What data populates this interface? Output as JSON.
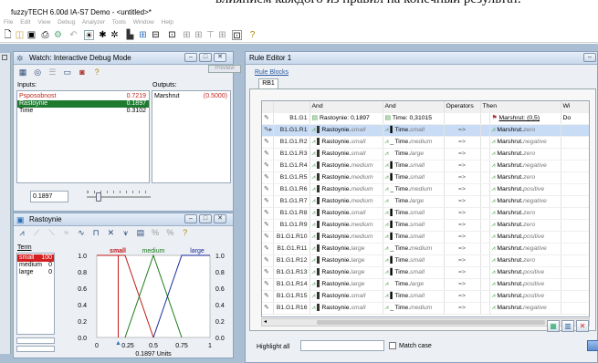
{
  "top_caption": "влиянием каждого из правил на конечный результат.",
  "app": {
    "title": "fuzzyTECH 6.00d IA-S7 Demo - <untitled>*"
  },
  "menu": [
    "File",
    "Edit",
    "View",
    "Debug",
    "Analyzer",
    "Tools",
    "Window",
    "Help"
  ],
  "toolbar_icons": [
    "new-icon",
    "open-icon",
    "save-icon",
    "print-icon",
    "compile-icon",
    "undo-icon",
    "debug-icon",
    "variables-icon",
    "rules-icon",
    "analyzer-icon",
    "chart-icon",
    "plot-icon",
    "window-icon",
    "window2-icon",
    "window3-icon",
    "window4-icon",
    "window5-icon",
    "layout-icon",
    "help-icon"
  ],
  "watch": {
    "title": "Watch: Interactive Debug Mode",
    "partial_title": "Preview",
    "inputs_label": "Inputs:",
    "outputs_label": "Outputs:",
    "inputs": [
      {
        "name": "Psposobnost",
        "value": "0.7219",
        "selected": false
      },
      {
        "name": "Rastoynie",
        "value": "0.1897",
        "selected": true
      },
      {
        "name": "Time",
        "value": "0.3102",
        "selected": false
      }
    ],
    "outputs": [
      {
        "name": "Marshrut",
        "value": "(0.5000)"
      }
    ],
    "input_value": "0.1897",
    "slider_value": 0.19
  },
  "var_editor": {
    "title": "Rastoynie",
    "term_label": "Term",
    "terms": [
      {
        "name": "small",
        "value": "100",
        "selected": true
      },
      {
        "name": "medium",
        "value": "0",
        "selected": false
      },
      {
        "name": "large",
        "value": "0",
        "selected": false
      }
    ],
    "chart_terms": [
      "small",
      "medium",
      "large"
    ],
    "y_ticks": [
      "1.0",
      "0.8",
      "0.6",
      "0.4",
      "0.2",
      "0.0"
    ],
    "x_ticks": [
      "0",
      "0.25",
      "0.5",
      "0.75",
      "1"
    ],
    "x_readout": "0.1897 Units",
    "marker_value": 0.1897
  },
  "rule_editor": {
    "title": "Rule Editor 1",
    "rule_blocks_label": "Rule Blocks",
    "tab": "RB1",
    "headers": {
      "and1": "And",
      "and2": "And",
      "operators": "Operators",
      "then": "Then",
      "w": "Wi",
      "do": "Do"
    },
    "row0": {
      "id": "B1.G1",
      "rast": "Rastoynie: 0,1897",
      "time": "Time: 0,31015",
      "then": "Marshrut: (0,5)"
    },
    "rules": [
      {
        "id": "B1.G1.R1",
        "rast": "small",
        "time": "small",
        "out": "zero",
        "sel": true
      },
      {
        "id": "B1.G1.R2",
        "rast": "small",
        "time": "medium",
        "out": "negative",
        "sel": false
      },
      {
        "id": "B1.G1.R3",
        "rast": "small",
        "time": "large",
        "out": "zero",
        "sel": false
      },
      {
        "id": "B1.G1.R4",
        "rast": "medium",
        "time": "small",
        "out": "negative",
        "sel": false
      },
      {
        "id": "B1.G1.R5",
        "rast": "medium",
        "time": "small",
        "out": "zero",
        "sel": false
      },
      {
        "id": "B1.G1.R6",
        "rast": "medium",
        "time": "medium",
        "out": "positive",
        "sel": false
      },
      {
        "id": "B1.G1.R7",
        "rast": "medium",
        "time": "large",
        "out": "negative",
        "sel": false
      },
      {
        "id": "B1.G1.R8",
        "rast": "small",
        "time": "small",
        "out": "zero",
        "sel": false
      },
      {
        "id": "B1.G1.R9",
        "rast": "medium",
        "time": "small",
        "out": "zero",
        "sel": false
      },
      {
        "id": "B1.G1.R10",
        "rast": "medium",
        "time": "small",
        "out": "positive",
        "sel": false
      },
      {
        "id": "B1.G1.R11",
        "rast": "large",
        "time": "medium",
        "out": "negative",
        "sel": false
      },
      {
        "id": "B1.G1.R12",
        "rast": "large",
        "time": "small",
        "out": "zero",
        "sel": false
      },
      {
        "id": "B1.G1.R13",
        "rast": "large",
        "time": "small",
        "out": "positive",
        "sel": false
      },
      {
        "id": "B1.G1.R14",
        "rast": "large",
        "time": "large",
        "out": "positive",
        "sel": false
      },
      {
        "id": "B1.G1.R15",
        "rast": "small",
        "time": "small",
        "out": "positive",
        "sel": false
      },
      {
        "id": "B1.G1.R16",
        "rast": "small",
        "time": "medium",
        "out": "negative",
        "sel": false
      }
    ],
    "rast_prefix": "Rastoynie.",
    "time_prefix": "Time.",
    "out_prefix": "Marshrut.",
    "op": "=>",
    "highlight_label": "Highlight all",
    "match_case_label": "Match case"
  }
}
